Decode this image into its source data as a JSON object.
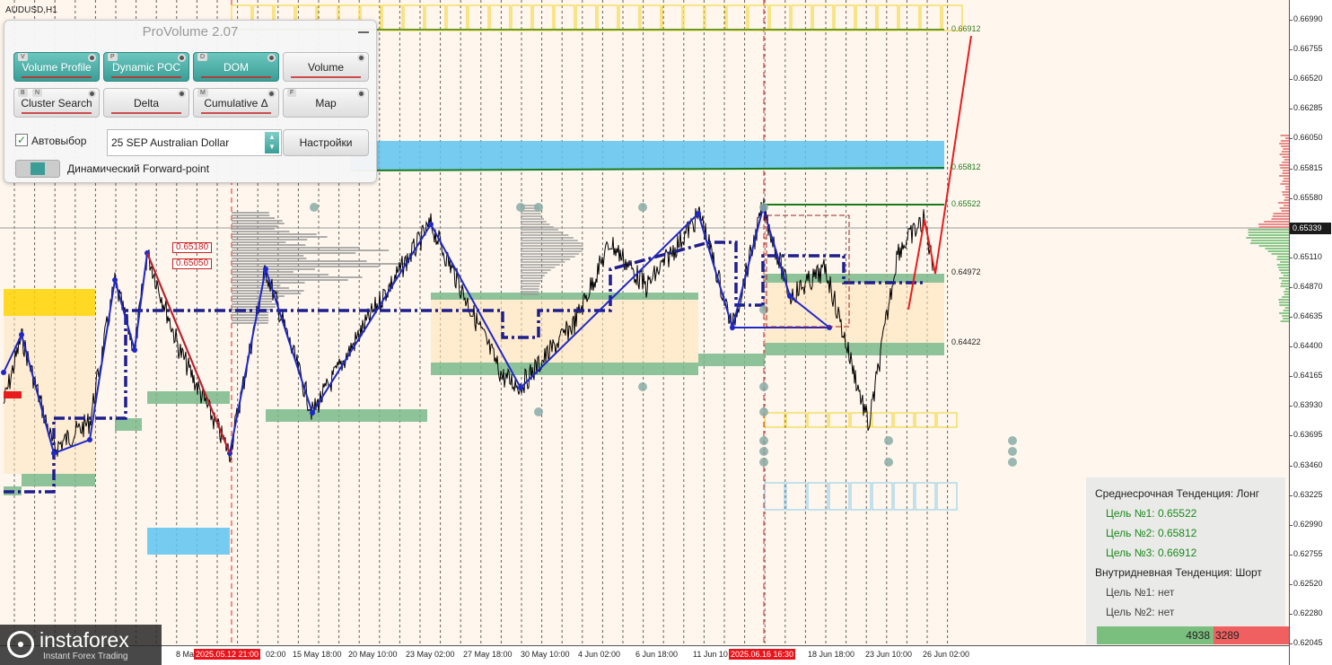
{
  "symbol": "AUDUSD,H1",
  "panel": {
    "title": "ProVolume 2.07",
    "buttons": [
      {
        "label": "Volume Profile",
        "key": "V",
        "active": true
      },
      {
        "label": "Dynamic POC",
        "key": "P",
        "active": true
      },
      {
        "label": "DOM",
        "key": "D",
        "active": true
      },
      {
        "label": "Volume",
        "key": "",
        "active": false
      },
      {
        "label": "Cluster Search",
        "key": "B",
        "key2": "N",
        "active": false
      },
      {
        "label": "Delta",
        "key": "",
        "active": false
      },
      {
        "label": "Cumulative Δ",
        "key": "M",
        "active": false
      },
      {
        "label": "Map",
        "key": "F",
        "active": false
      }
    ],
    "auto_select_label": "Автовыбор",
    "auto_select_checked": true,
    "instrument_value": "25 SEP Australian Dollar",
    "settings_label": "Настройки",
    "forward_point_label": "Динамический Forward-point"
  },
  "price_axis": {
    "ticks": [
      "0.66990",
      "0.66755",
      "0.66520",
      "0.66285",
      "0.66050",
      "0.65815",
      "0.65580",
      "0.65339",
      "0.65110",
      "0.64870",
      "0.64635",
      "0.64400",
      "0.64165",
      "0.63930",
      "0.63695",
      "0.63460",
      "0.63225",
      "0.62990",
      "0.62755",
      "0.62520",
      "0.62280",
      "0.62045"
    ],
    "current_price": "0.65339"
  },
  "time_axis": {
    "labels": [
      "8 Ma",
      "15 May 18:00",
      "20 May 10:00",
      "23 May 02:00",
      "27 May 18:00",
      "30 May 10:00",
      "4 Jun 02:00",
      "6 Jun 18:00",
      "11 Jun 10",
      "18 Jun 18:00",
      "23 Jun 10:00",
      "26 Jun 02:00"
    ],
    "highlight_1": "2025.05.12 21:00",
    "highlight_2": "2025.06.16 16:30",
    "partial": "02:00"
  },
  "levels": {
    "l1": "0.66912",
    "l2": "0.65812",
    "l3": "0.65522",
    "l4": "0.64972",
    "l5": "0.64422",
    "box1": "0.65180",
    "box2": "0.65050"
  },
  "info": {
    "mid_trend": "Среднесрочная Тенденция: Лонг",
    "target1": "Цель №1: 0.65522",
    "target2": "Цель №2: 0.65812",
    "target3": "Цель №3: 0.66912",
    "intraday_trend": "Внутридневная Тенденция: Шорт",
    "intraday_t1": "Цель №1: нет",
    "intraday_t2": "Цель №2: нет",
    "buy_volume": "4938",
    "sell_volume": "3289"
  },
  "logo": {
    "name": "instaforex",
    "tagline": "Instant Forex Trading"
  },
  "colors": {
    "background": "#fff7ee",
    "price_line": "#000000",
    "zigzag": "#1e28c8",
    "poc_dash": "#1e1e8c",
    "green_zone": "#7ab88a",
    "blue_zone": "#5ec4f0",
    "yellow_zone": "#ffd400",
    "forecast": "#e81c1c"
  }
}
